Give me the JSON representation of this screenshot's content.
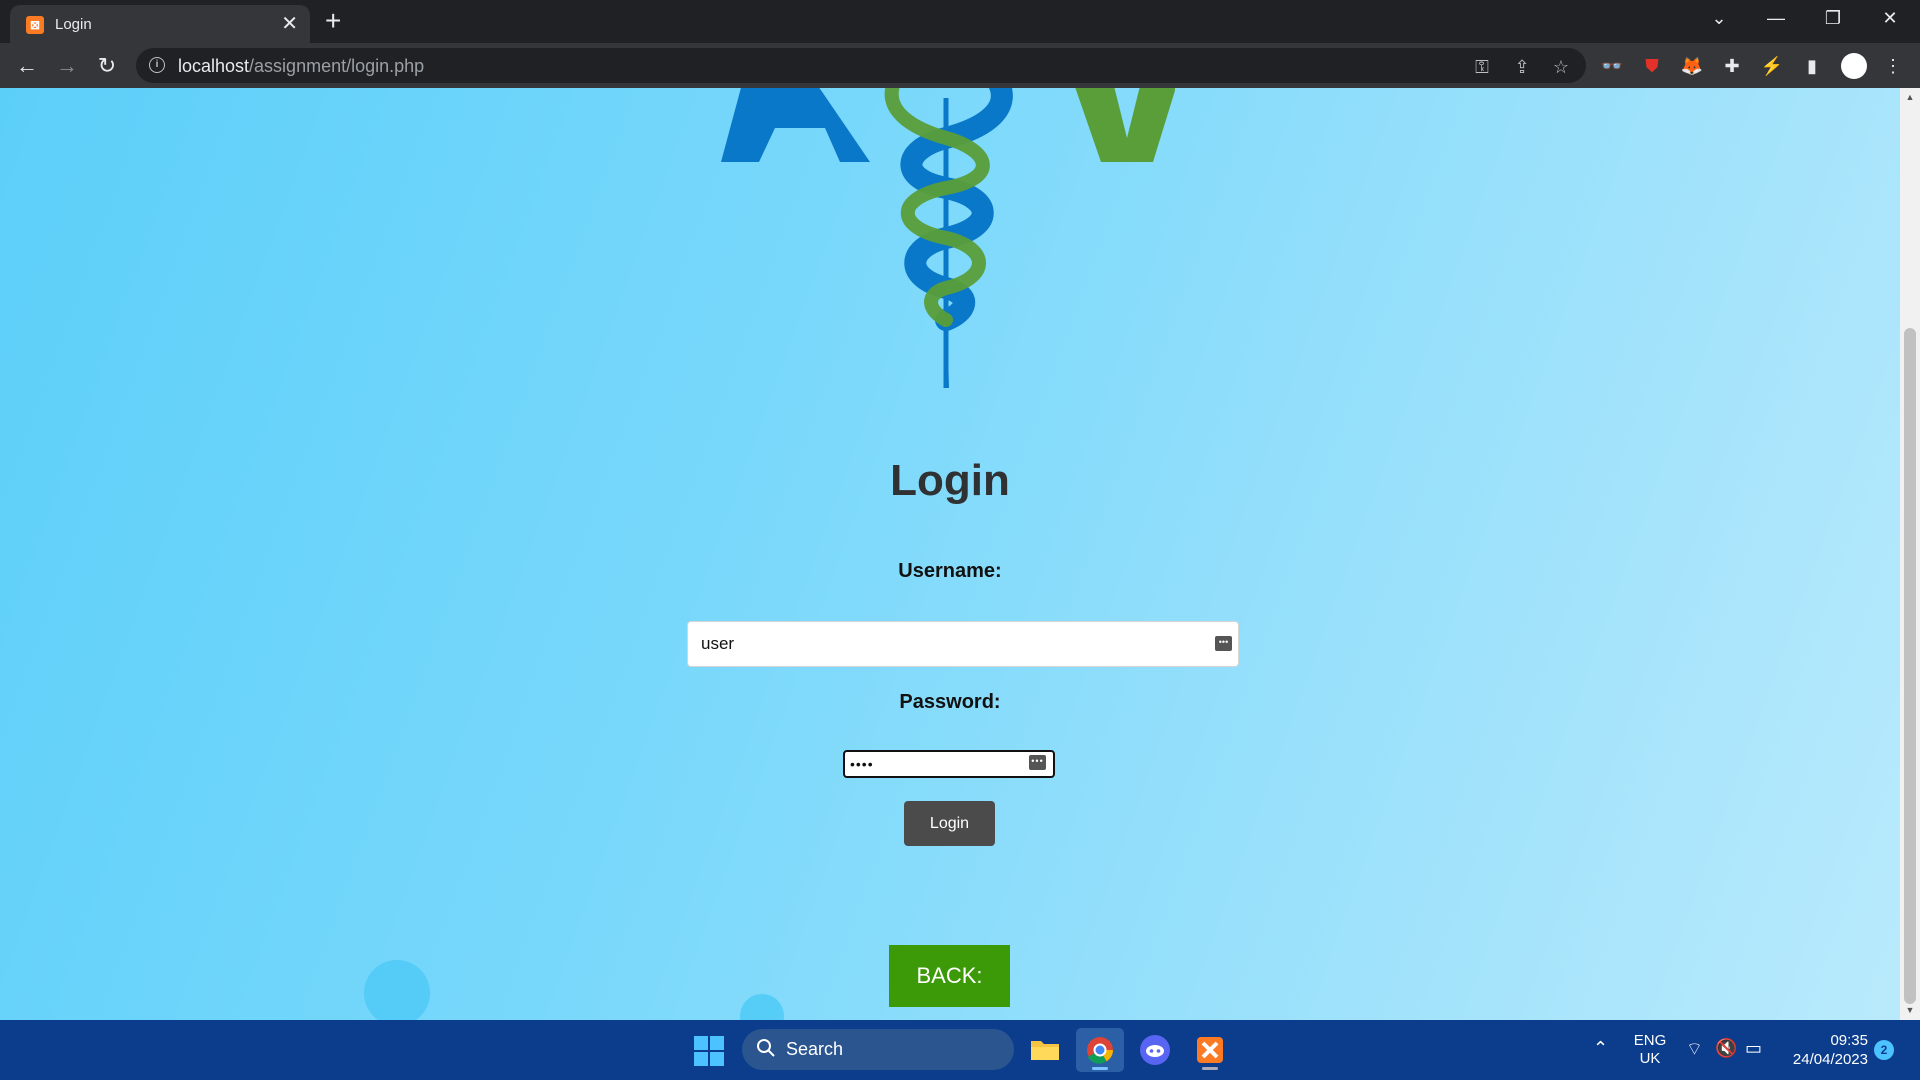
{
  "browser": {
    "tab_title": "Login",
    "tab_favicon": "xampp-icon",
    "url_host": "localhost",
    "url_path": "/assignment/login.php",
    "new_tab_glyph": "+",
    "close_glyph": "✕"
  },
  "page": {
    "heading": "Login",
    "username_label": "Username:",
    "username_value": "user",
    "password_label": "Password:",
    "password_value": "••••",
    "login_button": "Login",
    "back_button": "BACK:",
    "colors": {
      "logo_blue": "#0a78c8",
      "logo_green": "#5a9e3a",
      "back_button": "#3c9a09",
      "login_button": "#4b4b4b"
    }
  },
  "taskbar": {
    "search_label": "Search",
    "language_primary": "ENG",
    "language_secondary": "UK",
    "time": "09:35",
    "date": "24/04/2023",
    "notification_count": "2"
  }
}
